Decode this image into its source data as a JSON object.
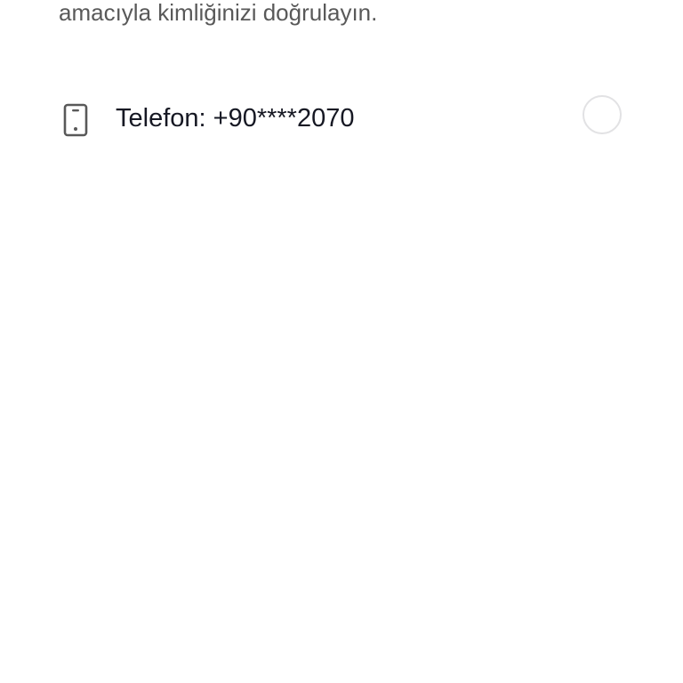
{
  "description": {
    "text": "amacıyla kimliğinizi doğrulayın."
  },
  "options": [
    {
      "icon": "mobile-phone-icon",
      "label": "Telefon: +90****2070",
      "selected": false
    }
  ],
  "colors": {
    "description_text": "#595959",
    "label_text": "#161823",
    "icon_stroke": "#595959",
    "radio_border": "#e2e2e4",
    "background": "#ffffff"
  }
}
